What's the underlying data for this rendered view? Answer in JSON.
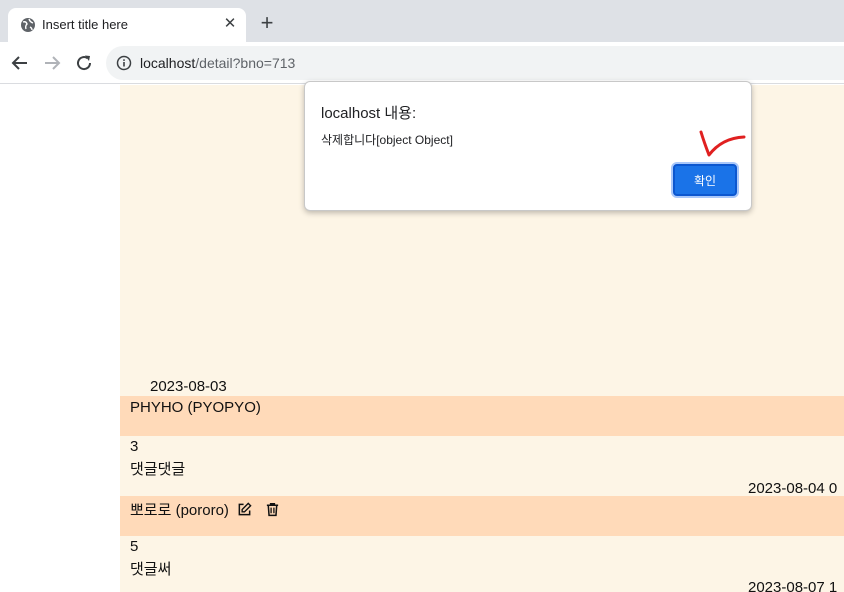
{
  "browser": {
    "tab_title": "Insert title here",
    "close_tab_glyph": "✕",
    "new_tab_glyph": "+",
    "url_host": "localhost",
    "url_path": "/detail?bno=713"
  },
  "comments": {
    "first_date": "2023-08-03",
    "items": [
      {
        "author": "PHYHO (PYOPYO)",
        "number": "3",
        "text": "댓글댓글",
        "date": "2023-08-04 0"
      },
      {
        "author": "뽀로로 (pororo)",
        "number": "5",
        "text": "댓글써",
        "date": "2023-08-07 1"
      }
    ]
  },
  "dialog": {
    "title": "localhost 내용:",
    "message": "삭제합니다[object Object]",
    "ok_label": "확인"
  },
  "colors": {
    "content_bg": "#fdf5e6",
    "author_row_bg": "#ffdab9",
    "ok_button": "#1a73e8",
    "annotation_mark": "#e02020"
  }
}
